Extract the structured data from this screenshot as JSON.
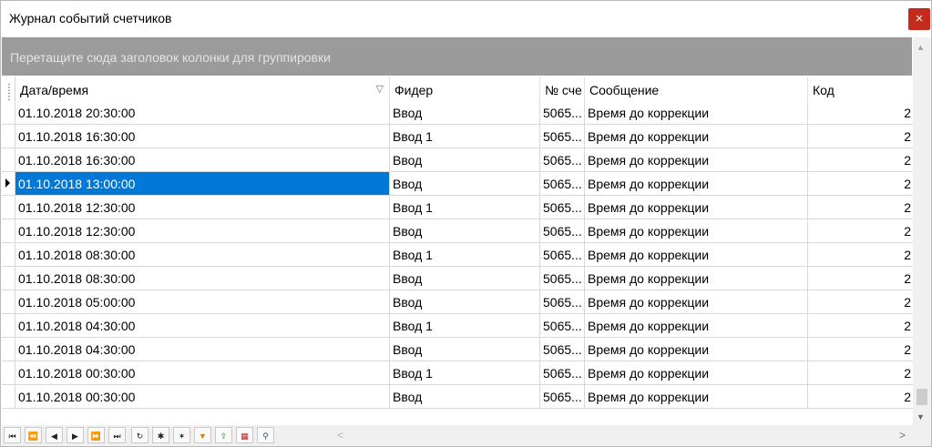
{
  "window": {
    "title": "Журнал событий счетчиков",
    "close_label": "×"
  },
  "group_panel": {
    "hint": "Перетащите сюда заголовок колонки для группировки"
  },
  "columns": {
    "datetime": "Дата/время",
    "feeder": "Фидер",
    "counter": "№ сче",
    "message": "Сообщение",
    "code": "Код"
  },
  "rows": [
    {
      "datetime": "01.10.2018 20:30:00",
      "feeder": "Ввод",
      "counter": "5065...",
      "message": "Время до коррекции",
      "code": "2"
    },
    {
      "datetime": "01.10.2018 16:30:00",
      "feeder": "Ввод 1",
      "counter": "5065...",
      "message": "Время до коррекции",
      "code": "2"
    },
    {
      "datetime": "01.10.2018 16:30:00",
      "feeder": "Ввод",
      "counter": "5065...",
      "message": "Время до коррекции",
      "code": "2"
    },
    {
      "datetime": "01.10.2018 13:00:00",
      "feeder": "Ввод",
      "counter": "5065...",
      "message": "Время до коррекции",
      "code": "2"
    },
    {
      "datetime": "01.10.2018 12:30:00",
      "feeder": "Ввод 1",
      "counter": "5065...",
      "message": "Время до коррекции",
      "code": "2"
    },
    {
      "datetime": "01.10.2018 12:30:00",
      "feeder": "Ввод",
      "counter": "5065...",
      "message": "Время до коррекции",
      "code": "2"
    },
    {
      "datetime": "01.10.2018 08:30:00",
      "feeder": "Ввод 1",
      "counter": "5065...",
      "message": "Время до коррекции",
      "code": "2"
    },
    {
      "datetime": "01.10.2018 08:30:00",
      "feeder": "Ввод",
      "counter": "5065...",
      "message": "Время до коррекции",
      "code": "2"
    },
    {
      "datetime": "01.10.2018 05:00:00",
      "feeder": "Ввод",
      "counter": "5065...",
      "message": "Время до коррекции",
      "code": "2"
    },
    {
      "datetime": "01.10.2018 04:30:00",
      "feeder": "Ввод 1",
      "counter": "5065...",
      "message": "Время до коррекции",
      "code": "2"
    },
    {
      "datetime": "01.10.2018 04:30:00",
      "feeder": "Ввод",
      "counter": "5065...",
      "message": "Время до коррекции",
      "code": "2"
    },
    {
      "datetime": "01.10.2018 00:30:00",
      "feeder": "Ввод 1",
      "counter": "5065...",
      "message": "Время до коррекции",
      "code": "2"
    },
    {
      "datetime": "01.10.2018 00:30:00",
      "feeder": "Ввод",
      "counter": "5065...",
      "message": "Время до коррекции",
      "code": "2"
    }
  ],
  "selected_row": 3,
  "colors": {
    "selection": "#0078d7",
    "close": "#c42b1c",
    "group_panel": "#9b9b9b"
  },
  "navigator": [
    {
      "name": "first-record-icon",
      "glyph": "⏮"
    },
    {
      "name": "prev-page-icon",
      "glyph": "⏪"
    },
    {
      "name": "prev-record-icon",
      "glyph": "◀"
    },
    {
      "name": "next-record-icon",
      "glyph": "▶"
    },
    {
      "name": "next-page-icon",
      "glyph": "⏩"
    },
    {
      "name": "last-record-icon",
      "glyph": "⏭"
    },
    {
      "name": "refresh-icon",
      "glyph": "↻"
    },
    {
      "name": "insert-icon",
      "glyph": "✱"
    },
    {
      "name": "delete-icon",
      "glyph": "✶"
    },
    {
      "name": "filter-icon",
      "glyph": "▼"
    },
    {
      "name": "export-icon",
      "glyph": "⇪"
    },
    {
      "name": "columns-icon",
      "glyph": "▦"
    },
    {
      "name": "find-icon",
      "glyph": "⚲"
    }
  ]
}
